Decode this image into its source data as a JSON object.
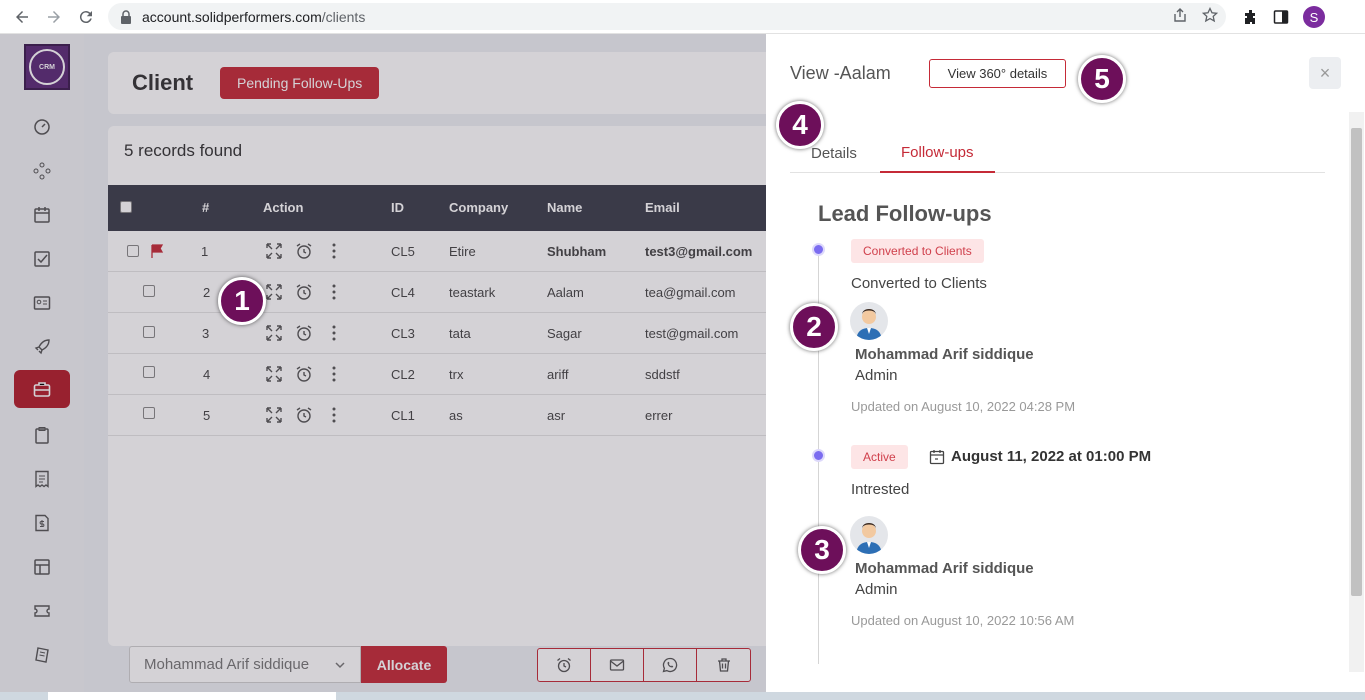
{
  "browser": {
    "url_host": "account.solidperformers.com",
    "url_path": "/clients",
    "profile_initial": "S"
  },
  "sidebar": {
    "logo_text": "CRM",
    "items": [
      {
        "icon": "dashboard-icon"
      },
      {
        "icon": "network-icon"
      },
      {
        "icon": "calendar-icon"
      },
      {
        "icon": "task-check-icon"
      },
      {
        "icon": "contact-card-icon"
      },
      {
        "icon": "rocket-icon"
      },
      {
        "icon": "briefcase-icon",
        "active": true
      },
      {
        "icon": "clipboard-icon"
      },
      {
        "icon": "receipt-icon"
      },
      {
        "icon": "invoice-dollar-icon"
      },
      {
        "icon": "table-icon"
      },
      {
        "icon": "ticket-icon"
      },
      {
        "icon": "documents-icon"
      }
    ]
  },
  "header": {
    "title": "Client",
    "pending_label": "Pending Follow-Ups"
  },
  "list": {
    "records_found": "5 records found",
    "columns": [
      "#",
      "Action",
      "ID",
      "Company",
      "Name",
      "Email"
    ],
    "rows": [
      {
        "num": "1",
        "id": "CL5",
        "company": "Etire",
        "name": "Shubham",
        "email": "test3@gmail.com",
        "flagged": true
      },
      {
        "num": "2",
        "id": "CL4",
        "company": "teastark",
        "name": "Aalam",
        "email": "tea@gmail.com"
      },
      {
        "num": "3",
        "id": "CL3",
        "company": "tata",
        "name": "Sagar",
        "email": "test@gmail.com"
      },
      {
        "num": "4",
        "id": "CL2",
        "company": "trx",
        "name": "ariff",
        "email": "sddstf"
      },
      {
        "num": "5",
        "id": "CL1",
        "company": "as",
        "name": "asr",
        "email": "errer"
      }
    ]
  },
  "bottom": {
    "assignee": "Mohammad Arif siddique",
    "allocate_label": "Allocate"
  },
  "panel": {
    "title": "View -Aalam",
    "view360_label": "View 360° details",
    "close_label": "×",
    "tabs": [
      "Details",
      "Follow-ups"
    ],
    "active_tab": "Follow-ups",
    "section_title": "Lead Follow-ups",
    "followups": [
      {
        "badge": "Converted to Clients",
        "note": "Converted to Clients",
        "user": "Mohammad Arif siddique",
        "role": "Admin",
        "updated": "Updated on August 10, 2022 04:28 PM"
      },
      {
        "badge": "Active",
        "date": "August 11, 2022 at 01:00 PM",
        "note": "Intrested",
        "user": "Mohammad Arif siddique",
        "role": "Admin",
        "updated": "Updated on August 10, 2022 10:56 AM"
      }
    ]
  },
  "callouts": [
    "1",
    "2",
    "3",
    "4",
    "5"
  ],
  "colors": {
    "accent": "#c52a37",
    "sidebar_active": "#b31d2a",
    "callout": "#6d0f5a",
    "timeline_dot": "#7b6cf0"
  }
}
